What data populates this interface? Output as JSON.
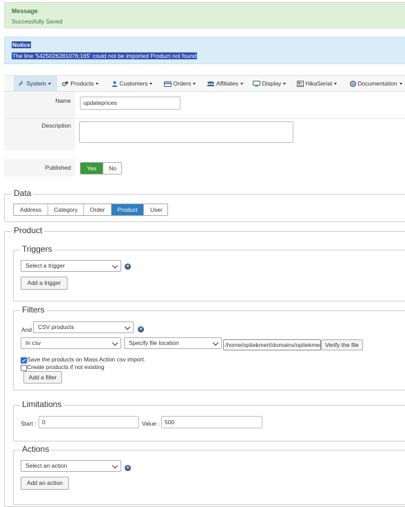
{
  "message": {
    "title": "Message",
    "text": "Successfully Saved"
  },
  "notice": {
    "title": "Notice",
    "text": "The line '5425026281076;165' could not be imported Product not found"
  },
  "toolbar": [
    {
      "label": "System",
      "icon": "wrench-icon"
    },
    {
      "label": "Products",
      "icon": "products-icon"
    },
    {
      "label": "Customers",
      "icon": "user-icon"
    },
    {
      "label": "Orders",
      "icon": "card-icon"
    },
    {
      "label": "Affiliates",
      "icon": "group-icon"
    },
    {
      "label": "Display",
      "icon": "monitor-icon"
    },
    {
      "label": "HikaSerial",
      "icon": "serial-icon"
    },
    {
      "label": "Documentation",
      "icon": "lifebuoy-icon"
    }
  ],
  "form": {
    "name_label": "Name",
    "name_value": "updateprices",
    "description_label": "Description",
    "description_value": "",
    "published_label": "Published",
    "yes": "Yes",
    "no": "No"
  },
  "data_section": {
    "legend": "Data",
    "tabs": [
      "Address",
      "Category",
      "Order",
      "Product",
      "User"
    ],
    "active_tab": "Product"
  },
  "product_legend": "Product",
  "triggers": {
    "legend": "Triggers",
    "select": "Select a trigger",
    "add_button": "Add a trigger"
  },
  "filters": {
    "legend": "Filters",
    "and_label": "And",
    "type_select": "CSV products",
    "mode_select": "In csv",
    "file_select": "Specify file location",
    "path_value": "/home/optiekmert/domains/optiekmert",
    "verify_button": "Verify the file",
    "checkbox1_label": "Save the products on Mass Action csv import.",
    "checkbox1_checked": true,
    "checkbox2_label": "Create products if not existing",
    "checkbox2_checked": false,
    "add_button": "Add a filter"
  },
  "limitations": {
    "legend": "Limitations",
    "start_label": "Start :",
    "start_value": "0",
    "value_label": "Value :",
    "value_value": "500"
  },
  "actions": {
    "legend": "Actions",
    "select": "Select an action",
    "add_button": "Add an action"
  },
  "colors": {
    "accent": "#2f7fc1",
    "yes_green": "#3c9a3c",
    "success_bg": "#dff0d8",
    "info_bg": "#d9edf7"
  }
}
